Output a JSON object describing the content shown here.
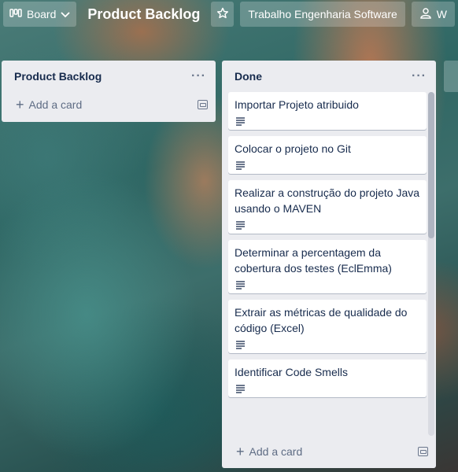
{
  "header": {
    "view_switcher_label": "Board",
    "board_title": "Product Backlog",
    "workspace_label": "Trabalho Engenharia Software",
    "visibility_label": "W"
  },
  "lists": [
    {
      "title": "Product Backlog",
      "menu": "···",
      "add_card_label": "Add a card",
      "cards": []
    },
    {
      "title": "Done",
      "menu": "···",
      "add_card_label": "Add a card",
      "cards": [
        {
          "title": "Importar Projeto atribuido"
        },
        {
          "title": "Colocar o projeto no Git"
        },
        {
          "title": "Realizar a construção do projeto Java usando o MAVEN"
        },
        {
          "title": "Determinar a percentagem da cobertura dos testes (EclEmma)"
        },
        {
          "title": "Extrair as métricas de qualidade do código (Excel)"
        },
        {
          "title": "Identificar Code Smells"
        }
      ]
    }
  ],
  "icons": {
    "board": "board-icon",
    "chevron": "chevron-down-icon",
    "star": "star-icon",
    "visibility": "people-icon",
    "add": "plus-icon",
    "template": "template-icon",
    "description": "description-icon"
  },
  "colors": {
    "list_bg": "#ebecf0",
    "text": "#172b4d",
    "muted": "#5e6c84"
  }
}
